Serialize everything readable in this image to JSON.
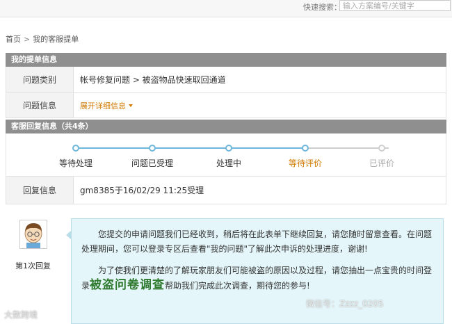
{
  "topbar": {
    "search_label": "快速搜索：",
    "search_placeholder": "输入方案编号/关键字"
  },
  "breadcrumb": {
    "home": "首页",
    "separator": ">",
    "current": "我的客服提单"
  },
  "ticket_section": {
    "title": "我的提单信息",
    "rows": [
      {
        "label": "问题类别",
        "value": "帐号修复问题 > 被盗物品快速取回通道"
      },
      {
        "label": "问题信息",
        "value": "展开详细信息"
      }
    ]
  },
  "reply_section": {
    "title": "客服回复信息（共4条）",
    "progress_current_step": 4,
    "steps": [
      {
        "label": "等待处理",
        "state": "done",
        "color": "#333333"
      },
      {
        "label": "问题已受理",
        "state": "done",
        "color": "#333333"
      },
      {
        "label": "处理中",
        "state": "done",
        "color": "#333333"
      },
      {
        "label": "等待评价",
        "state": "current",
        "color": "#d07a00"
      },
      {
        "label": "已评价",
        "state": "pending",
        "color": "#aaaaaa"
      }
    ],
    "info_label": "回复信息",
    "info_value": "gm8385于16/02/29 11:25受理"
  },
  "reply": {
    "index_label": "第1次回复",
    "paragraph1": "您提交的申请问题我们已经收到，稍后将在此表单下继续回复，请您随时留意查看。在问题处理期间，您可以登录专区后查看\"我的问题\"了解此次申诉的处理进度，谢谢!",
    "paragraph2_before": "为了使我们更清楚的了解玩家朋友们可能被盗的原因以及过程，请您抽出一点宝贵的时间登录",
    "survey_link": "被盗问卷调查",
    "paragraph2_after": "帮助我们完成此次调查，期待您的参与!"
  },
  "watermarks": {
    "left": "大数跨境",
    "right": "微信号：Zzzz_0205"
  },
  "colors": {
    "accent_blue": "#6fb6dc",
    "orange": "#d07a00",
    "header_gray": "#8f8f8f",
    "bubble_bg": "#e4f6fa"
  }
}
